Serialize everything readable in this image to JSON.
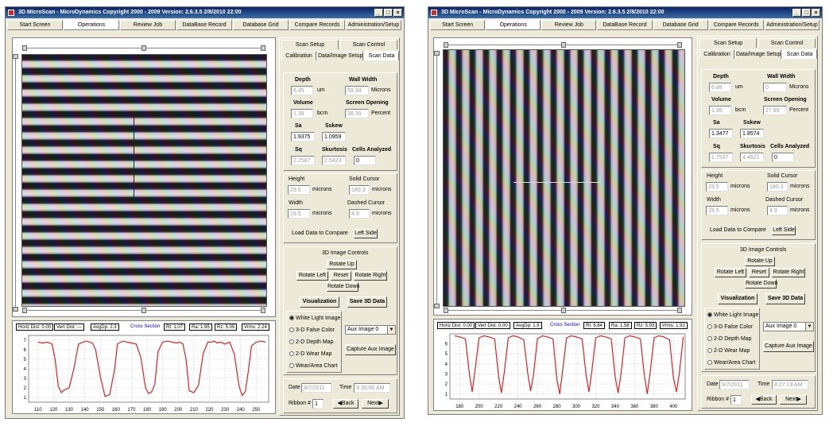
{
  "windows": [
    {
      "title": "3D MicroScan - MicroDynamics Copyright 2000 - 2009 Version: 2.6.3.5    2/8/2010 22:00",
      "window_buttons": [
        "_",
        "□",
        "×"
      ],
      "tabs": [
        "Start Screen",
        "Operations",
        "Review Job",
        "DataBase Record",
        "Database Grid",
        "Compare Records",
        "Administration/Setup"
      ],
      "active_tab": 1,
      "stats": {
        "horiz": "Horiz Dist: 0.00",
        "vert": "Vert Dist: ---",
        "avgdp": "AvgDp: 2.3",
        "cross": "Cross Section",
        "rt": "Rt: 1.07",
        "ra": "Ra: 1.95",
        "rz": "Rz: 5.05",
        "vrms": "Vrms: 2.24"
      },
      "chart_data": {
        "type": "line",
        "x": [
          110,
          113,
          116,
          119,
          121,
          123,
          125,
          127,
          130,
          133,
          136,
          139,
          141,
          143,
          145,
          147,
          150,
          153,
          156,
          159,
          161,
          163,
          165,
          167,
          170,
          173,
          176,
          179,
          181,
          183,
          185,
          187,
          190,
          193,
          196,
          199,
          201,
          203,
          205,
          207,
          210,
          213,
          216,
          219,
          221,
          223,
          225,
          227,
          230,
          233,
          236,
          239,
          241,
          243,
          245,
          247,
          250,
          253,
          256
        ],
        "y": [
          6.8,
          6.7,
          6.8,
          6.6,
          5.0,
          2.2,
          1.5,
          1.8,
          2.0,
          4.0,
          6.6,
          6.8,
          6.9,
          6.8,
          6.7,
          6.0,
          3.2,
          1.1,
          1.3,
          3.8,
          6.6,
          6.8,
          6.9,
          6.8,
          6.7,
          6.6,
          5.2,
          2.0,
          1.4,
          1.6,
          2.4,
          5.8,
          6.8,
          6.9,
          6.8,
          6.7,
          6.8,
          6.6,
          5.0,
          1.7,
          1.5,
          2.3,
          5.6,
          6.8,
          6.8,
          6.9,
          6.7,
          6.8,
          6.6,
          6.8,
          5.5,
          2.2,
          1.2,
          1.6,
          3.8,
          6.4,
          6.8,
          6.9,
          6.8
        ],
        "xticks": [
          110,
          120,
          130,
          140,
          150,
          160,
          170,
          180,
          190,
          200,
          210,
          220,
          230,
          240,
          250
        ],
        "yticks": [
          1,
          2,
          3,
          4,
          5,
          6,
          7
        ],
        "xlim": [
          104,
          258
        ],
        "ylim": [
          0.5,
          7.5
        ],
        "color": "#e02020",
        "grid": true
      },
      "panel": {
        "subtabs_top": [
          "Scan Setup",
          "Scan Control"
        ],
        "subtabs_bottom": [
          "Calibration",
          "Data/Image Setup",
          "Scan Data"
        ],
        "depth_label": "Depth",
        "depth_value": "6.45",
        "depth_unit": "um",
        "wallwidth_label": "Wall Width",
        "wallwidth_value": "59.34",
        "wallwidth_unit": "Microns",
        "volume_label": "Volume",
        "volume_value": "1.38",
        "volume_unit": "bcm",
        "screen_label": "Screen Opening",
        "screen_value": "38.39",
        "screen_unit": "Percent",
        "sa_label": "Sa",
        "sa_value": "1.9375",
        "sskew_label": "Sskew",
        "sskew_value": "1.0959",
        "sq_label": "Sq",
        "sq_value": "2.2587",
        "sku_label": "Skurtosis",
        "sku_value": "2.5423",
        "cells_label": "Cells Analyzed",
        "cells_value": "0",
        "height_label": "Height",
        "height_value": "29.5",
        "height_unit": "microns",
        "solid_label": "Solid Cursor",
        "solid_value": "180.3",
        "solid_unit": "microns",
        "width_label": "Width",
        "width_value": "29.5",
        "width_unit": "microns",
        "dashed_label": "Dashed Cursor",
        "dashed_value": "4.9",
        "dashed_unit": "microns",
        "load_label": "Load Data to Compare",
        "left_side": "Left Side",
        "controls_title": "3D Image Controls",
        "rotate_up": "Rotate Up",
        "rotate_left": "Rotate Left",
        "reset": "Reset",
        "rotate_right": "Rotate Right",
        "rotate_down": "Rotate Down",
        "visualization": "Visualization",
        "save3d": "Save 3D Data",
        "radios": [
          "White Light Image",
          "3-D False Color",
          "2-D Depth Map",
          "2-D Wear Map",
          "Wear/Area Chart"
        ],
        "aux_select": "Aux Image 0",
        "capture_aux": "Capture Aux Image",
        "date_label": "Date",
        "date_value": "9/7/2011",
        "time_label": "Time",
        "time_value": "9:35:00 AM",
        "ribbon_label": "Ribbon #",
        "ribbon_value": "1",
        "back": "Back",
        "next": "Next"
      }
    },
    {
      "title": "3D MicroScan - MicroDynamics Copyright 2000 - 2009 Version: 2.6.3.5    2/8/2010 22:00",
      "window_buttons": [
        "_",
        "□",
        "×"
      ],
      "tabs": [
        "Start Screen",
        "Operations",
        "Review Job",
        "DataBase Record",
        "Database Grid",
        "Compare Records",
        "Administration/Setup"
      ],
      "active_tab": 1,
      "stats": {
        "horiz": "Horiz Dist: 0.00",
        "vert": "Vert Dist: 0.00",
        "avgdp": "AvgDp: 1.9",
        "cross": "Cross Section",
        "rt": "Rt: 6.64",
        "ra": "Ra: 1.58",
        "rz": "Rz: 5.93",
        "vrms": "Vrms: 1.92"
      },
      "chart_data": {
        "type": "line",
        "x": [
          175,
          180,
          186,
          190,
          193,
          196,
          200,
          205,
          210,
          216,
          220,
          223,
          226,
          230,
          235,
          240,
          246,
          250,
          253,
          256,
          260,
          265,
          270,
          276,
          280,
          283,
          286,
          290,
          295,
          300,
          306,
          310,
          313,
          316,
          320,
          325,
          330,
          336,
          340,
          343,
          346,
          350,
          355,
          360,
          366,
          370,
          373,
          376,
          380,
          385,
          390,
          396,
          400,
          403,
          406,
          410
        ],
        "y": [
          6.8,
          6.7,
          6.5,
          3.0,
          1.2,
          3.5,
          6.6,
          6.8,
          6.7,
          6.5,
          2.8,
          1.1,
          3.2,
          6.6,
          6.8,
          6.7,
          6.4,
          3.1,
          1.3,
          2.9,
          6.5,
          6.8,
          6.7,
          6.5,
          2.5,
          1.0,
          3.4,
          6.6,
          6.8,
          6.7,
          6.5,
          3.0,
          1.2,
          3.3,
          6.6,
          6.8,
          6.7,
          6.5,
          2.7,
          1.1,
          3.0,
          6.6,
          6.8,
          6.7,
          6.5,
          2.9,
          1.0,
          3.2,
          6.6,
          6.8,
          6.7,
          6.4,
          2.6,
          1.2,
          3.1,
          6.7
        ],
        "xticks": [
          180,
          200,
          220,
          240,
          260,
          280,
          300,
          320,
          340,
          360,
          380,
          400
        ],
        "yticks": [
          1,
          2,
          3,
          4,
          5,
          6
        ],
        "xlim": [
          170,
          412
        ],
        "ylim": [
          0.5,
          7
        ],
        "color": "#e02020",
        "grid": true
      },
      "panel": {
        "subtabs_top": [
          "Scan Setup",
          "Scan Control"
        ],
        "subtabs_bottom": [
          "Calibration",
          "Data/Image Setup",
          "Scan Data"
        ],
        "depth_label": "Depth",
        "depth_value": "6.88",
        "depth_unit": "um",
        "wallwidth_label": "Wall Width",
        "wallwidth_value": "0",
        "wallwidth_unit": "Microns",
        "volume_label": "Volume",
        "volume_value": "1.95",
        "volume_unit": "bcm",
        "screen_label": "Screen Opening",
        "screen_value": "27.65",
        "screen_unit": "Percent",
        "sa_label": "Sa",
        "sa_value": "1.3477",
        "sskew_label": "Sskew",
        "sskew_value": "1.8574",
        "sq_label": "Sq",
        "sq_value": "1.7537",
        "sku_label": "Skurtosis",
        "sku_value": "4.4621",
        "cells_label": "Cells Analyzed",
        "cells_value": "0",
        "height_label": "Height",
        "height_value": "29.5",
        "height_unit": "microns",
        "solid_label": "Solid Cursor",
        "solid_value": "180.3",
        "solid_unit": "microns",
        "width_label": "Width",
        "width_value": "29.5",
        "width_unit": "microns",
        "dashed_label": "Dashed Cursor",
        "dashed_value": "4.9",
        "dashed_unit": "microns",
        "load_label": "Load Data to Compare",
        "left_side": "Left Side",
        "controls_title": "3D Image Controls",
        "rotate_up": "Rotate Up",
        "rotate_left": "Rotate Left",
        "reset": "Reset",
        "rotate_right": "Rotate Right",
        "rotate_down": "Rotate Down",
        "visualization": "Visualization",
        "save3d": "Save 3D Data",
        "radios": [
          "White Light Image",
          "3-D False Color",
          "2-D Depth Map",
          "2-D Wear Map",
          "Wear/Area Chart"
        ],
        "aux_select": "Aux Image 0",
        "capture_aux": "Capture Aux Image",
        "date_label": "Date",
        "date_value": "9/7/2011",
        "time_label": "Time",
        "time_value": "8:27:19 AM",
        "ribbon_label": "Ribbon #",
        "ribbon_value": "1",
        "back": "Back",
        "next": "Next"
      }
    }
  ]
}
